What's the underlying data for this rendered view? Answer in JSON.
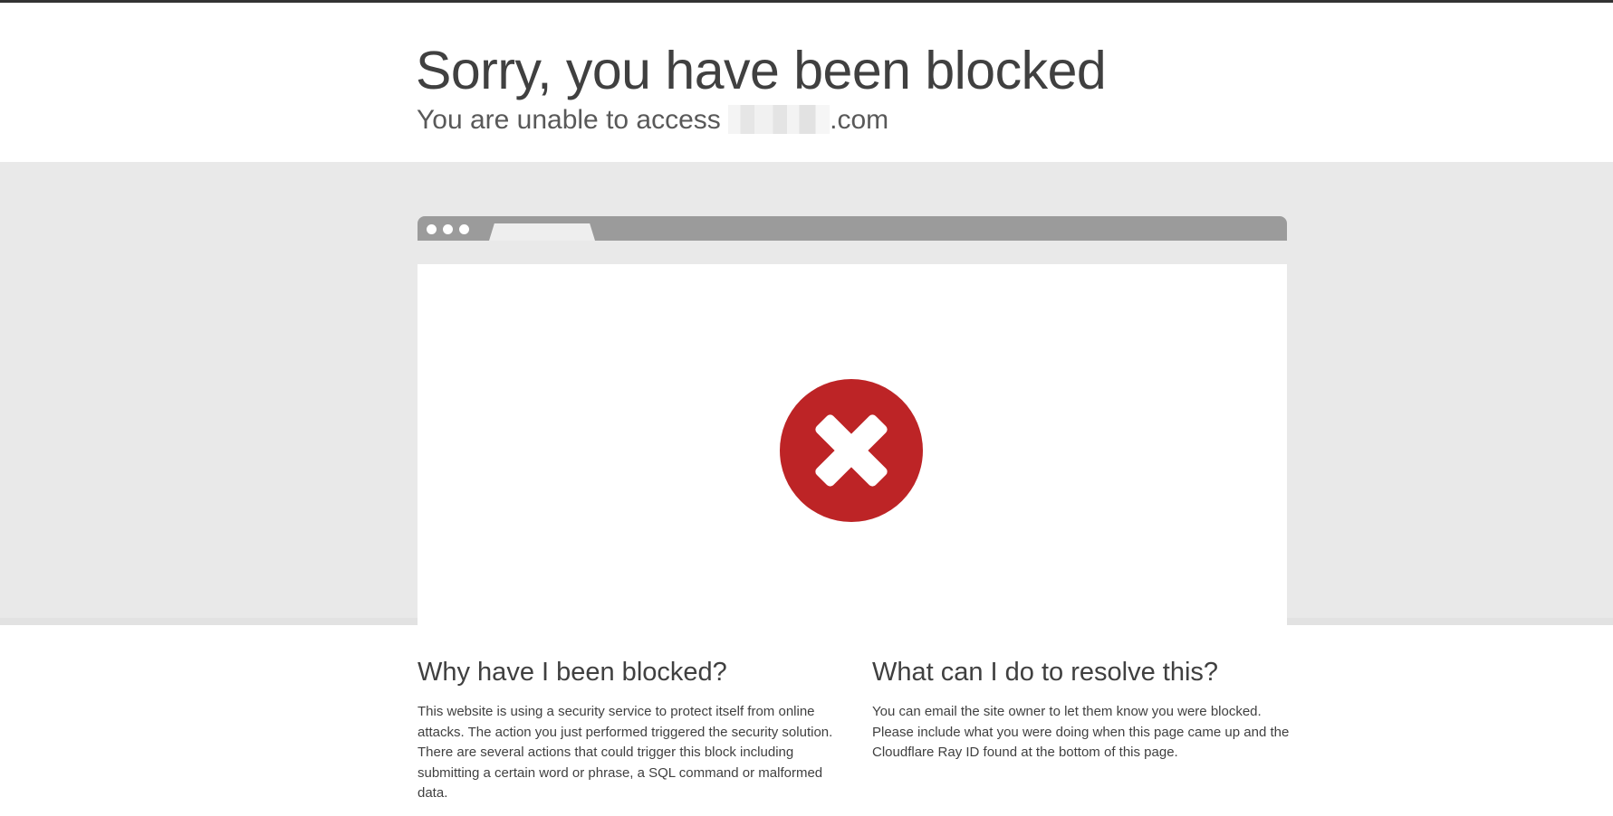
{
  "header": {
    "title": "Sorry, you have been blocked",
    "subtitle_prefix": "You are unable to access",
    "subtitle_suffix": ".com"
  },
  "icons": {
    "error": "error-x-circle-icon"
  },
  "colors": {
    "error_red": "#bd2426",
    "band_gray": "#e9e9e9",
    "browser_bar": "#9b9b9b"
  },
  "why": {
    "heading": "Why have I been blocked?",
    "body": "This website is using a security service to protect itself from online attacks. The action you just performed triggered the security solution. There are several actions that could trigger this block including submitting a certain word or phrase, a SQL command or malformed data."
  },
  "resolve": {
    "heading": "What can I do to resolve this?",
    "body": "You can email the site owner to let them know you were blocked. Please include what you were doing when this page came up and the Cloudflare Ray ID found at the bottom of this page."
  }
}
